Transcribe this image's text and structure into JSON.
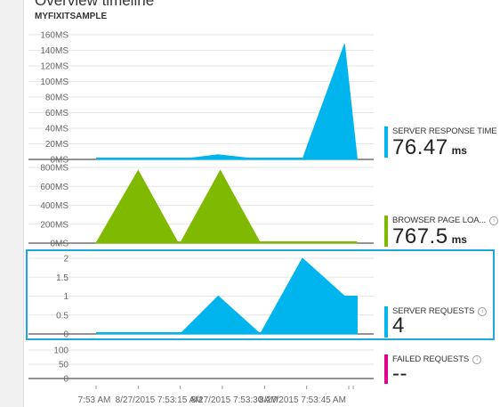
{
  "blade": {
    "title": "Overview timeline",
    "subtitle": "MYFIXITSAMPLE"
  },
  "colors": {
    "blue": "#00b4ee",
    "green": "#7fba00",
    "magenta": "#e3008c",
    "highlight": "#1ea7d9"
  },
  "metrics": [
    {
      "label": "SERVER RESPONSE TIME",
      "value": "76.47",
      "unit": "ms",
      "color": "#00b4ee",
      "info_icon": "info-icon"
    },
    {
      "label": "BROWSER PAGE LOA...",
      "value": "767.5",
      "unit": "ms",
      "color": "#7fba00",
      "info_icon": "info-icon"
    },
    {
      "label": "SERVER REQUESTS",
      "value": "4",
      "unit": "",
      "color": "#00b4ee",
      "info_icon": "info-icon"
    },
    {
      "label": "FAILED REQUESTS",
      "value": "--",
      "unit": "",
      "color": "#e3008c",
      "info_icon": "info-icon"
    }
  ],
  "chart_data": [
    {
      "type": "area",
      "name": "server-response-time",
      "ylim": [
        0,
        160
      ],
      "yticks": [
        "160MS",
        "140MS",
        "120MS",
        "100MS",
        "80MS",
        "60MS",
        "40MS",
        "20MS",
        "0MS"
      ],
      "ytick_values": [
        160,
        140,
        120,
        100,
        80,
        60,
        40,
        20,
        0
      ],
      "x": [
        0.0,
        1.0,
        2.0,
        2.9,
        3.9,
        4.9,
        5.9,
        6.2
      ],
      "values": [
        0,
        0,
        0,
        6,
        0,
        0,
        148,
        0
      ],
      "color": "#00b4ee"
    },
    {
      "type": "area",
      "name": "browser-page-load",
      "ylim": [
        0,
        800
      ],
      "yticks": [
        "800MS",
        "600MS",
        "400MS",
        "200MS",
        "0MS"
      ],
      "ytick_values": [
        800,
        600,
        400,
        200,
        0
      ],
      "x": [
        0.0,
        1.0,
        1.95,
        2.0,
        2.95,
        3.9,
        4.9,
        5.9,
        6.2
      ],
      "values": [
        0,
        767.5,
        0,
        0,
        767.5,
        0,
        0,
        0,
        0
      ],
      "color": "#7fba00"
    },
    {
      "type": "area",
      "name": "server-requests",
      "ylim": [
        0,
        2
      ],
      "yticks": [
        "2",
        "1.5",
        "1",
        "0.5",
        "0"
      ],
      "ytick_values": [
        2,
        1.5,
        1,
        0.5,
        0
      ],
      "x": [
        0.0,
        1.0,
        2.0,
        2.9,
        3.9,
        4.9,
        5.9,
        6.2
      ],
      "values": [
        0,
        0,
        0,
        1,
        0,
        2,
        1,
        1
      ],
      "color": "#00b4ee"
    },
    {
      "type": "line",
      "name": "failed-requests",
      "ylim": [
        0,
        100
      ],
      "yticks": [
        "100",
        "50",
        "0"
      ],
      "ytick_values": [
        100,
        50,
        0
      ],
      "x": [],
      "values": [],
      "color": "#e3008c"
    }
  ],
  "xaxis": {
    "ticks": [
      "7:53 AM",
      "8/27/2015 7:53:15 AM",
      "8/27/2015 7:53:30 AM",
      "8/27/2015 7:53:45 AM"
    ],
    "tick_display": [
      "7:53 AM",
      "8/27/2015 7:53:15",
      "8/27/2015 7:53:30",
      "8/27/2015 7:53:45 AM"
    ],
    "overlap_display": [
      "",
      "AM",
      "AM",
      ""
    ]
  }
}
